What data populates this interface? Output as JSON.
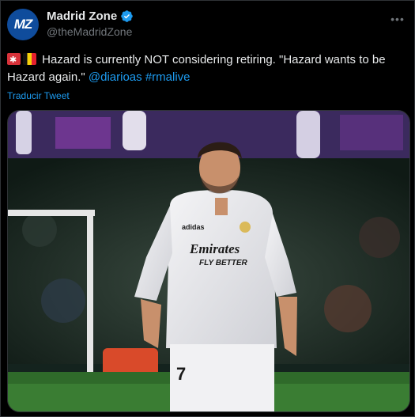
{
  "author": {
    "avatar_initials": "MZ",
    "display_name": "Madrid Zone",
    "handle": "@theMadridZone",
    "verified": true
  },
  "tweet": {
    "text_main": "Hazard is currently NOT considering retiring. \"Hazard wants to be Hazard again.\"",
    "mention": "@diarioas",
    "hashtag": "#rmalive",
    "translate_label": "Traducir Tweet"
  },
  "media": {
    "shirt_sponsor": "Emirates",
    "shirt_sub": "FLY BETTER",
    "shirt_number": "7"
  },
  "icons": {
    "more": "more-icon",
    "verified": "verified-badge-icon",
    "alarm": "rotating-light-icon",
    "flag": "belgium-flag-icon"
  },
  "colors": {
    "background": "#000000",
    "text": "#e7e9ea",
    "secondary": "#71767b",
    "link": "#1d9bf0",
    "avatar": "#0f4c9c"
  }
}
